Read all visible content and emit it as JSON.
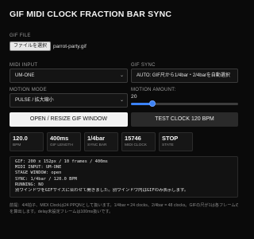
{
  "title": "GIF MIDI CLOCK FRACTION BAR SYNC",
  "gif_file": {
    "label": "GIF FILE",
    "button": "ファイルを選択",
    "filename": "parrot-party.gif"
  },
  "midi_input": {
    "label": "MIDI INPUT",
    "value": "UM-ONE"
  },
  "gif_sync": {
    "label": "GIF SYNC",
    "value": "AUTO: GIF尺から1/4bar・2/4barを自動選択"
  },
  "motion_mode": {
    "label": "MOTION MODE",
    "value": "PULSE / 拡大縮小"
  },
  "motion_amount": {
    "label": "MOTION AMOUNT:",
    "value": "20",
    "level_percent": 20
  },
  "buttons": {
    "open": "OPEN / RESIZE GIF WINDOW",
    "test": "TEST CLOCK 120 BPM"
  },
  "stats": [
    {
      "value": "120.0",
      "label": "BPM"
    },
    {
      "value": "400ms",
      "label": "GIF LENGTH"
    },
    {
      "value": "1/4bar",
      "label": "SYNC BAR"
    },
    {
      "value": "15746",
      "label": "MIDI CLOCK"
    },
    {
      "value": "STOP",
      "label": "STATE"
    }
  ],
  "log": [
    "GIF: 200 x 152px / 10 frames / 400ms",
    "MIDI INPUT: UM-ONE",
    "STAGE WINDOW: open",
    "SYNC: 1/4bar / 120.0 BPM",
    "RUNNING: NO",
    "別ウインドウをGIFサイズに合わせて開きました。別ウインドウ内はGIFのみ表示します。"
  ],
  "footer": [
    "前提：4/4拍子、MIDI Clockは24 PPQNとして扱います。1/4bar = 24 clocks、2/4bar = 48 clocks。GIFの尺が1は各フレームの",
    "を算出します。delay未設定フレームは100ms扱いです。"
  ]
}
